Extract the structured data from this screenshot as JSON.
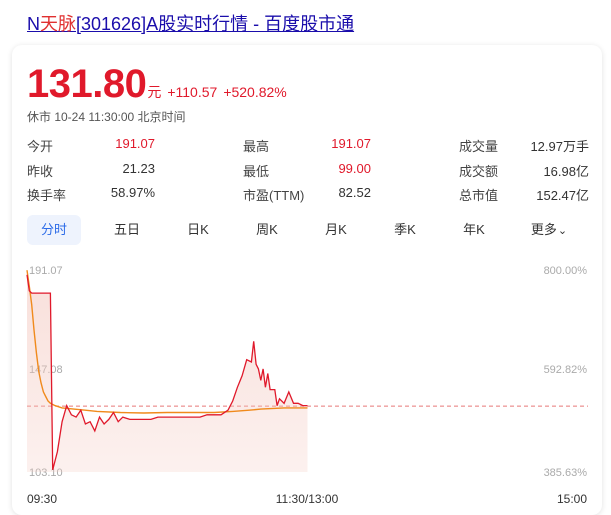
{
  "page_title": {
    "prefix": "N",
    "highlight": "天脉",
    "suffix": "[301626]A股实时行情 - 百度股市通"
  },
  "quote": {
    "price": "131.80",
    "unit": "元",
    "change": "+110.57",
    "change_pct": "+520.82%",
    "status": "休市 10-24 11:30:00 北京时间"
  },
  "stats": [
    {
      "label": "今开",
      "value": "191.07"
    },
    {
      "label": "最高",
      "value": "191.07"
    },
    {
      "label": "成交量",
      "value": "12.97万手"
    },
    {
      "label": "昨收",
      "value": "21.23"
    },
    {
      "label": "最低",
      "value": "99.00"
    },
    {
      "label": "成交额",
      "value": "16.98亿"
    },
    {
      "label": "换手率",
      "value": "58.97%"
    },
    {
      "label": "市盈(TTM)",
      "value": "82.52"
    },
    {
      "label": "总市值",
      "value": "152.47亿"
    }
  ],
  "tabs": [
    "分时",
    "五日",
    "日K",
    "周K",
    "月K",
    "季K",
    "年K",
    "更多"
  ],
  "active_tab": "分时",
  "colors": {
    "up": "#e0192b",
    "avg_line": "#f08a1c",
    "accent": "#2d6ce8"
  },
  "chart_data": {
    "type": "line",
    "y_left_ticks": [
      "191.07",
      "147.08",
      "103.10"
    ],
    "y_right_ticks": [
      "800.00%",
      "592.82%",
      "385.63%"
    ],
    "x_ticks": [
      "09:30",
      "11:30/13:00",
      "15:00"
    ],
    "ylim": [
      103.1,
      191.07
    ],
    "reference_price": 131.8,
    "session_length": 240,
    "series": [
      {
        "role": "price",
        "x": [
          0,
          1,
          2,
          3,
          4,
          5,
          6,
          7,
          8,
          9,
          10,
          11,
          13,
          15,
          17,
          19,
          21,
          23,
          25,
          27,
          29,
          31,
          33,
          35,
          37,
          39,
          41,
          44,
          47,
          50,
          53,
          56,
          59,
          62,
          65,
          68,
          71,
          74,
          77,
          80,
          83,
          86,
          88,
          90,
          92,
          94,
          96,
          97,
          98,
          99,
          100,
          101,
          102,
          103,
          104,
          105,
          106,
          107,
          108,
          110,
          112,
          114,
          116,
          118,
          120
        ],
        "values": [
          189,
          182,
          181,
          181,
          181,
          181,
          181,
          181,
          181,
          181,
          181,
          104,
          112,
          125,
          132,
          128,
          127,
          130,
          124,
          125,
          121,
          127,
          124,
          126,
          129,
          125,
          127,
          126,
          126,
          126,
          126,
          127,
          127,
          127,
          127,
          127,
          127,
          127,
          128,
          128,
          128,
          130,
          134,
          140,
          145,
          152,
          151,
          160,
          150,
          148,
          143,
          148,
          140,
          146,
          139,
          139,
          139,
          132,
          135,
          133,
          138,
          133,
          133,
          132,
          132
        ]
      },
      {
        "role": "average",
        "x": [
          0,
          1,
          2,
          3,
          4,
          5,
          6,
          7,
          8,
          9,
          10,
          12,
          15,
          20,
          25,
          30,
          40,
          50,
          60,
          70,
          80,
          88,
          95,
          100,
          110,
          120
        ],
        "values": [
          191,
          184,
          176,
          165,
          155,
          147,
          142,
          138,
          136,
          134,
          133,
          132,
          131,
          130.5,
          130,
          129.5,
          129,
          128.8,
          129,
          129,
          129,
          129.5,
          130,
          130.5,
          131,
          131
        ]
      }
    ]
  }
}
